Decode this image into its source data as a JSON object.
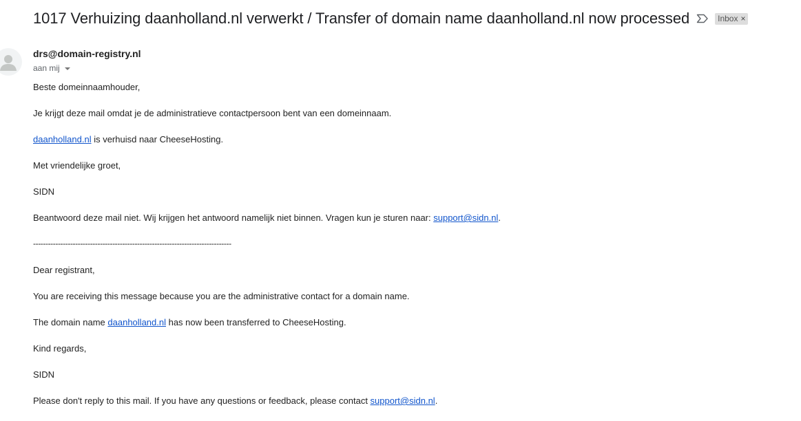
{
  "email": {
    "subject": "1017 Verhuizing daanholland.nl verwerkt / Transfer of domain name daanholland.nl now processed",
    "label": "Inbox",
    "label_remove": "×",
    "sender": "drs@domain-registry.nl",
    "recipient": "aan mij"
  },
  "body": {
    "nl_greeting": "Beste domeinnaamhouder,",
    "nl_reason": "Je krijgt deze mail omdat je de administratieve contactpersoon bent van een domeinnaam.",
    "nl_domain_link": "daanholland.nl",
    "nl_domain_text": " is verhuisd naar CheeseHosting.",
    "nl_closing": "Met vriendelijke groet,",
    "nl_signature": "SIDN",
    "nl_noreply_text": "Beantwoord deze mail niet. Wij krijgen het antwoord namelijk niet binnen. Vragen kun je sturen naar: ",
    "nl_support_link": "support@sidn.nl",
    "nl_noreply_end": ".",
    "separator": "--------------------------------------------------------------------------------",
    "en_greeting": "Dear registrant,",
    "en_reason": "You are receiving this message because you are the administrative contact for a domain name.",
    "en_domain_prefix": "The domain name ",
    "en_domain_link": "daanholland.nl",
    "en_domain_suffix": " has now been transferred to CheeseHosting.",
    "en_closing": "Kind regards,",
    "en_signature": "SIDN",
    "en_noreply_text": "Please don't reply to this mail. If you have any questions or feedback, please contact ",
    "en_support_link": "support@sidn.nl",
    "en_noreply_end": "."
  },
  "icons": {
    "important": "important-marker-icon",
    "avatar": "default-avatar-icon",
    "caret": "chevron-down-icon"
  },
  "colors": {
    "link": "#1155cc",
    "label_bg": "#dddddd",
    "text": "#222222"
  }
}
